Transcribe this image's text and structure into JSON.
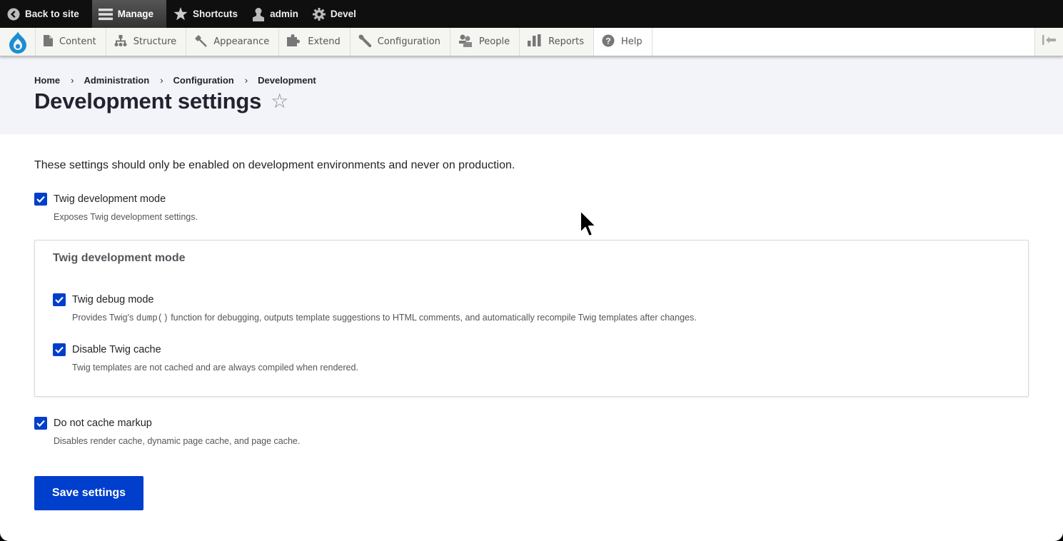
{
  "toolbar": {
    "items": [
      {
        "label": "Back to site",
        "icon": "back-arrow-circle-icon"
      },
      {
        "label": "Manage",
        "icon": "hamburger-menu-icon",
        "active": true
      },
      {
        "label": "Shortcuts",
        "icon": "star-icon"
      },
      {
        "label": "admin",
        "icon": "user-icon"
      },
      {
        "label": "Devel",
        "icon": "gear-icon"
      }
    ]
  },
  "tray": {
    "logo": "drupal-logo",
    "items": [
      {
        "label": "Content",
        "icon": "file-icon"
      },
      {
        "label": "Structure",
        "icon": "sitemap-icon"
      },
      {
        "label": "Appearance",
        "icon": "paintbrush-icon"
      },
      {
        "label": "Extend",
        "icon": "puzzle-icon"
      },
      {
        "label": "Configuration",
        "icon": "wrench-icon"
      },
      {
        "label": "People",
        "icon": "people-icon"
      },
      {
        "label": "Reports",
        "icon": "bar-chart-icon"
      },
      {
        "label": "Help",
        "icon": "help-icon",
        "active": true
      }
    ],
    "toggle_icon": "collapse-tray-icon"
  },
  "breadcrumb": [
    "Home",
    "Administration",
    "Configuration",
    "Development"
  ],
  "breadcrumb_separator": "›",
  "page": {
    "title": "Development settings",
    "shortcut_star": "☆"
  },
  "form": {
    "intro": "These settings should only be enabled on development environments and never on production.",
    "twig_dev_mode": {
      "label": "Twig development mode",
      "checked": true,
      "description": "Exposes Twig development settings."
    },
    "fieldset": {
      "legend": "Twig development mode",
      "twig_debug": {
        "label": "Twig debug mode",
        "checked": true,
        "description_before": "Provides Twig's ",
        "description_code": "dump()",
        "description_after": " function for debugging, outputs template suggestions to HTML comments, and automatically recompile Twig templates after changes."
      },
      "twig_cache": {
        "label": "Disable Twig cache",
        "checked": true,
        "description": "Twig templates are not cached and are always compiled when rendered."
      }
    },
    "no_cache_markup": {
      "label": "Do not cache markup",
      "checked": true,
      "description": "Disables render cache, dynamic page cache, and page cache."
    },
    "submit_label": "Save settings"
  },
  "colors": {
    "primary": "#003ecc",
    "toolbar_bg": "#0f0f0f",
    "header_bg": "#f3f4f9"
  }
}
